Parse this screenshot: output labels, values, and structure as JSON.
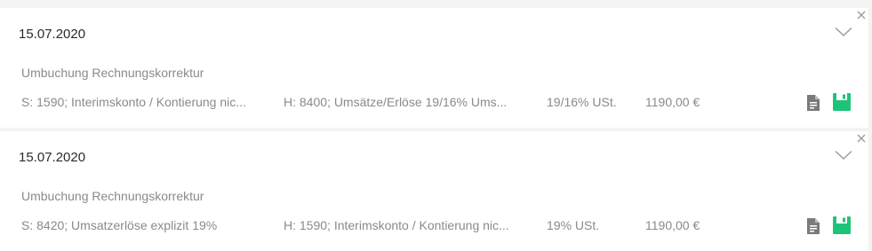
{
  "entries": [
    {
      "date": "15.07.2020",
      "description": "Umbuchung Rechnungskorrektur",
      "soll": "S: 1590; Interimskonto / Kontierung nic...",
      "haben": "H: 8400; Umsätze/Erlöse 19/16% Ums...",
      "tax": "19/16% USt.",
      "amount": "1190,00 €"
    },
    {
      "date": "15.07.2020",
      "description": "Umbuchung Rechnungskorrektur",
      "soll": "S: 8420; Umsatzerlöse explizit 19%",
      "haben": "H: 1590; Interimskonto / Kontierung nic...",
      "tax": "19% USt.",
      "amount": "1190,00 €"
    }
  ],
  "icons": {
    "close": "close-icon",
    "chevron": "chevron-down-icon",
    "document": "document-icon",
    "save": "save-icon"
  },
  "colors": {
    "save_green": "#1ec37a",
    "document_gray": "#7a7a7a",
    "background": "#f3f3f1"
  }
}
